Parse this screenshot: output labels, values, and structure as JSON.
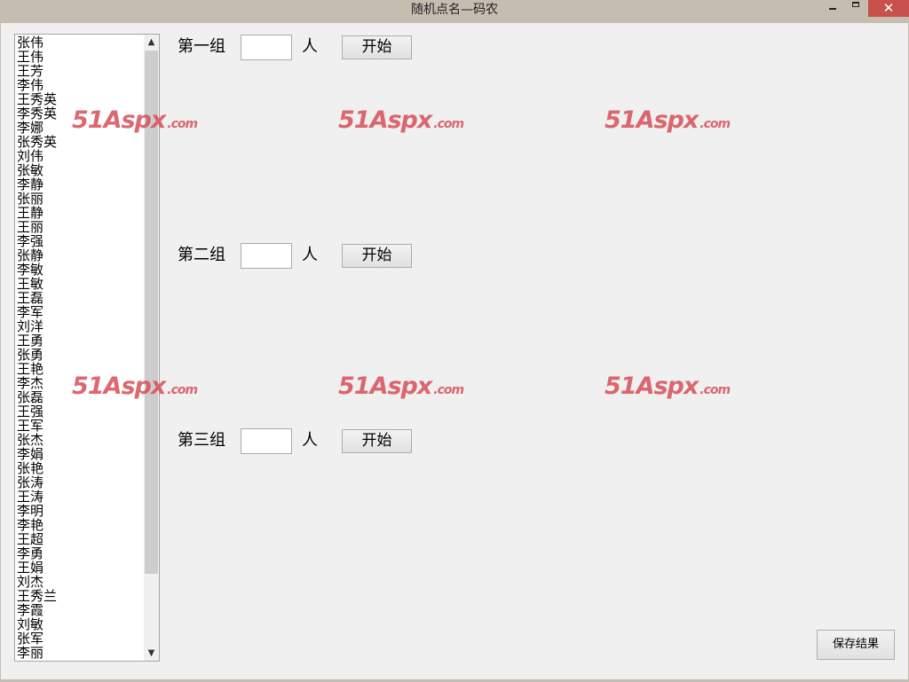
{
  "window": {
    "title": "随机点名—码农",
    "minimize_glyph": "",
    "maximize_glyph": "",
    "close_glyph": "✕"
  },
  "names": [
    "张伟",
    "王伟",
    "王芳",
    "李伟",
    "王秀英",
    "李秀英",
    "李娜",
    "张秀英",
    "刘伟",
    "张敏",
    "李静",
    "张丽",
    "王静",
    "王丽",
    "李强",
    "张静",
    "李敏",
    "王敏",
    "王磊",
    "李军",
    "刘洋",
    "王勇",
    "张勇",
    "王艳",
    "李杰",
    "张磊",
    "王强",
    "王军",
    "张杰",
    "李娟",
    "张艳",
    "张涛",
    "王涛",
    "李明",
    "李艳",
    "王超",
    "李勇",
    "王娟",
    "刘杰",
    "王秀兰",
    "李霞",
    "刘敏",
    "张军",
    "李丽"
  ],
  "scrollbar": {
    "up_glyph": "▲",
    "down_glyph": "▼"
  },
  "groups": [
    {
      "label": "第一组",
      "value": "",
      "unit": "人",
      "button": "开始"
    },
    {
      "label": "第二组",
      "value": "",
      "unit": "人",
      "button": "开始"
    },
    {
      "label": "第三组",
      "value": "",
      "unit": "人",
      "button": "开始"
    }
  ],
  "save_button": "保存结果",
  "watermark": {
    "main": "51Aspx",
    "suffix": ".com",
    "color": "#d84f58"
  }
}
